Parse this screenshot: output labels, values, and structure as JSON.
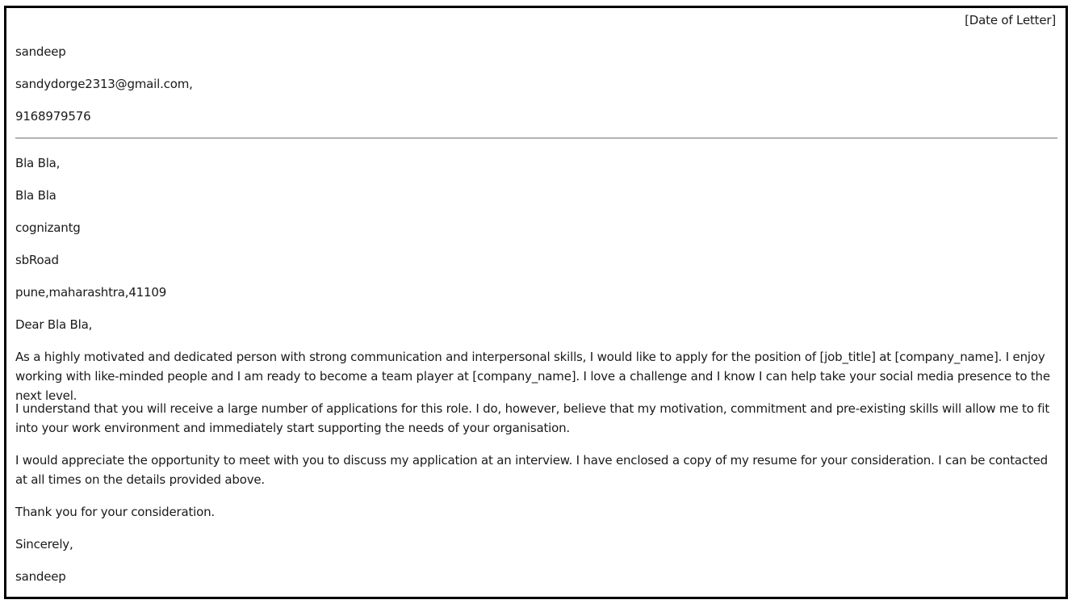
{
  "letter": {
    "date": "[Date of Letter]",
    "sender": {
      "name": "sandeep",
      "email": "sandydorge2313@gmail.com,",
      "phone": "9168979576"
    },
    "recipient": {
      "name": "Bla Bla,",
      "title": "Bla Bla",
      "company": "cognizantg",
      "street": "sbRoad",
      "city_line": "pune,maharashtra,41109"
    },
    "salutation": "Dear Bla Bla,",
    "paragraphs": [
      "As a highly motivated and dedicated person with strong communication and interpersonal skills, I would like to apply for the position of [job_title] at [company_name]. I enjoy working with like-minded people and I am ready to become a team player at [company_name]. I love a challenge and I know I can help take your social media presence to the next level.",
      "I understand that you will receive a large number of applications for this role. I do, however, believe that my motivation, commitment and pre-existing skills will allow me to fit into your work environment and immediately start supporting the needs of your organisation.",
      "I would appreciate the opportunity to meet with you to discuss my application at an interview. I have enclosed a copy of my resume for your consideration. I can be contacted at all times on the details provided above."
    ],
    "thanks": "Thank you for your consideration.",
    "closing": "Sincerely,",
    "signature": "sandeep"
  }
}
